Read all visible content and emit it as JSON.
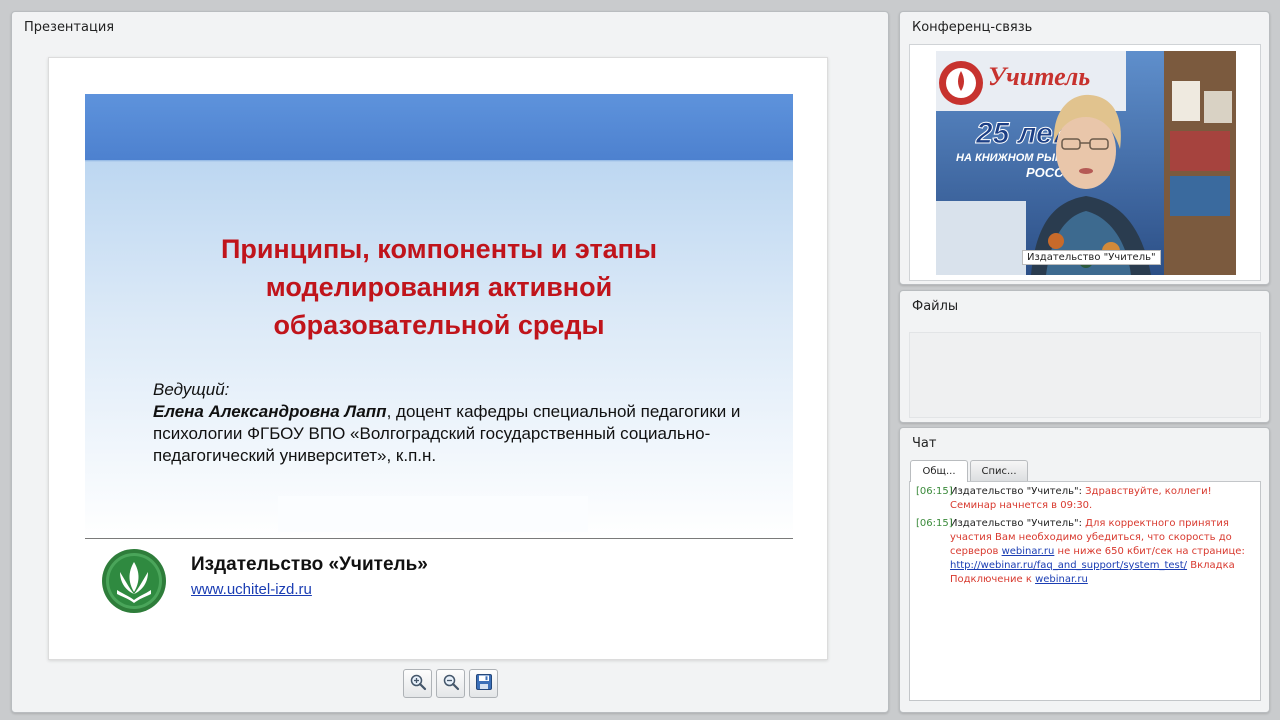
{
  "presentation": {
    "title": "Презентация",
    "slide": {
      "title": "Принципы, компоненты и этапы\nмоделирования активной\nобразовательной среды",
      "presenter_label": "Ведущий:",
      "presenter_name": "Елена Александровна Лапп",
      "presenter_details": ", доцент кафедры специальной педагогики и психологии ФГБОУ ВПО «Волгоградский государственный социально-педагогический университет», к.п.н.",
      "publisher_name": "Издательство «Учитель»",
      "publisher_url": "www.uchitel-izd.ru"
    },
    "toolbar": {
      "zoom_in": "zoom-in-icon",
      "zoom_out": "zoom-out-icon",
      "save": "save-icon"
    }
  },
  "conference": {
    "title": "Конференц-связь",
    "video_caption": "Издательство \"Учитель\""
  },
  "files": {
    "title": "Файлы"
  },
  "chat": {
    "title": "Чат",
    "tabs": [
      "Общ...",
      "Спис..."
    ],
    "messages": [
      {
        "time": "[06:15]",
        "author": "Издательство \"Учитель\":",
        "text": "Здравствуйте, коллеги! Семинар начнется в 09:30."
      },
      {
        "time": "[06:15]",
        "author": "Издательство \"Учитель\":",
        "text1": "Для корректного принятия участия Вам необходимо убедиться, что скорость до серверов",
        "link1": "webinar.ru",
        "text2": "не ниже 650 кбит/сек на странице:",
        "link2": "http://webinar.ru/faq_and_support/system_test/",
        "text3": "Вкладка Подключение к",
        "link3": "webinar.ru"
      }
    ]
  },
  "colors": {
    "slide_title": "#c0141b",
    "chat_text": "#d8392e",
    "chat_time": "#3a8a3a",
    "link": "#1a3db3"
  }
}
